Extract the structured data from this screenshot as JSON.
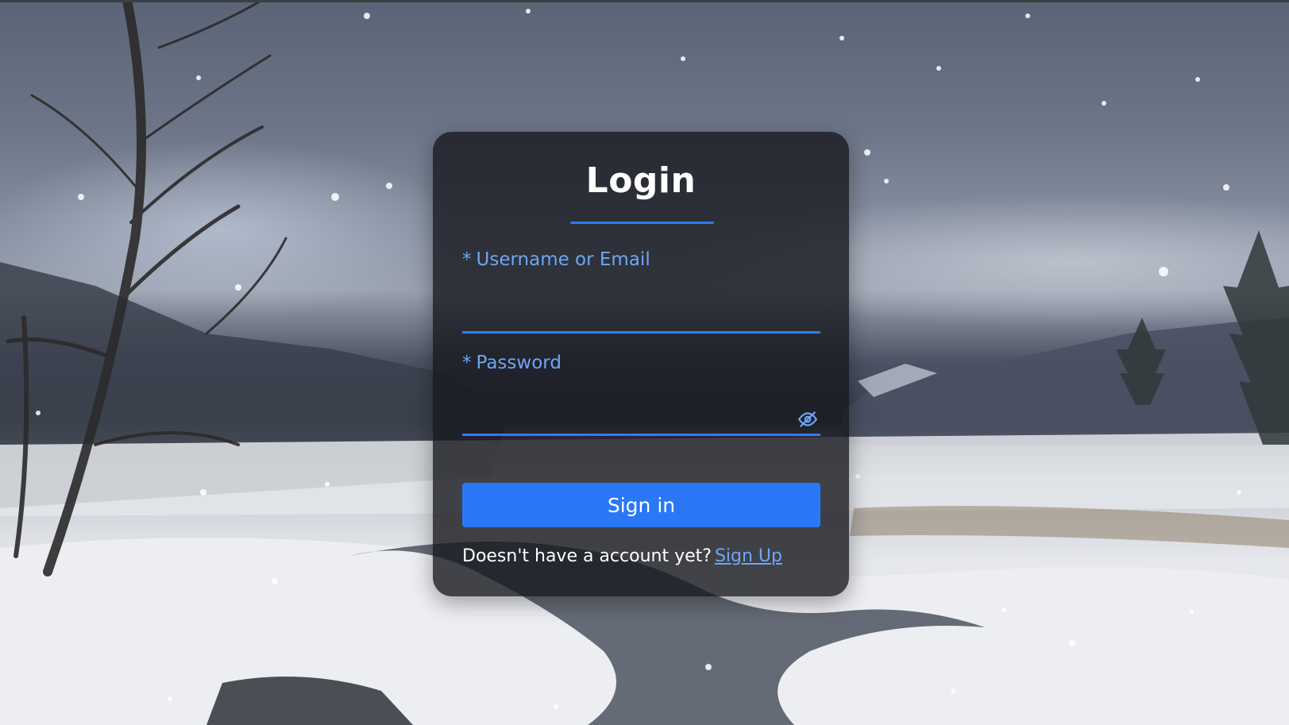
{
  "login": {
    "title": "Login",
    "username_label": "Username or Email",
    "password_label": "Password",
    "required_marker": "*",
    "username_value": "",
    "password_value": "",
    "password_toggle_icon": "eye-off-icon",
    "submit_label": "Sign in",
    "signup_prompt": "Doesn't have a account yet?",
    "signup_link": "Sign Up"
  },
  "colors": {
    "accent": "#2f7bf5",
    "label": "#6ea6f4",
    "button": "#2a78f6",
    "card_bg": "rgba(22, 24, 30, 0.80)"
  },
  "background": {
    "icon": "winter-landscape-image"
  }
}
